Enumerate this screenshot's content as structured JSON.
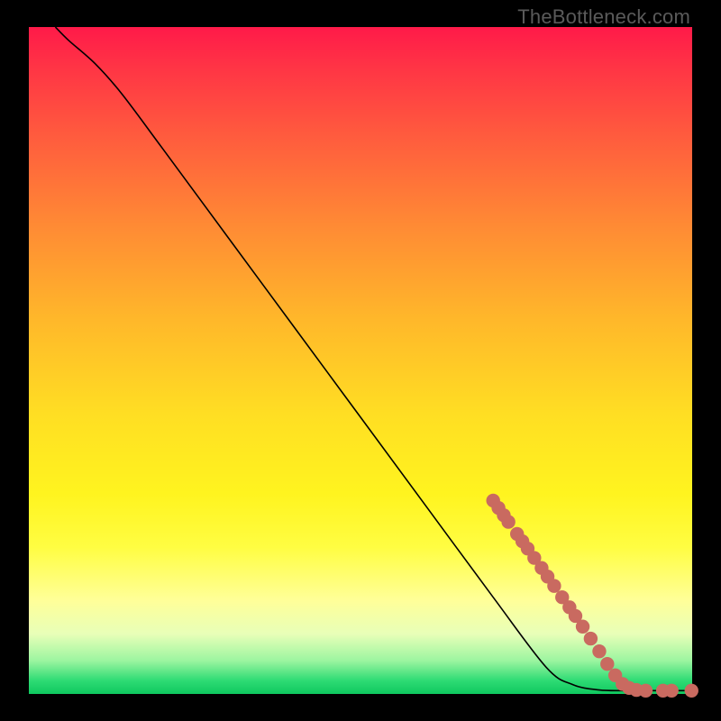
{
  "attribution": "TheBottleneck.com",
  "colors": {
    "dot": "#c96a60",
    "line": "#000000"
  },
  "chart_data": {
    "type": "line",
    "title": "",
    "xlabel": "",
    "ylabel": "",
    "xlim": [
      0,
      100
    ],
    "ylim": [
      0,
      100
    ],
    "curve": [
      {
        "x": 4,
        "y": 100
      },
      {
        "x": 6,
        "y": 98
      },
      {
        "x": 10,
        "y": 94.5
      },
      {
        "x": 14,
        "y": 90
      },
      {
        "x": 20,
        "y": 82
      },
      {
        "x": 30,
        "y": 68.5
      },
      {
        "x": 40,
        "y": 55
      },
      {
        "x": 50,
        "y": 41.5
      },
      {
        "x": 60,
        "y": 28
      },
      {
        "x": 70,
        "y": 14.5
      },
      {
        "x": 78,
        "y": 4
      },
      {
        "x": 82,
        "y": 1.4
      },
      {
        "x": 86,
        "y": 0.6
      },
      {
        "x": 90,
        "y": 0.5
      },
      {
        "x": 95,
        "y": 0.5
      },
      {
        "x": 100,
        "y": 0.5
      }
    ],
    "series": [
      {
        "name": "markers",
        "points": [
          {
            "x": 70.0,
            "y": 29.0
          },
          {
            "x": 70.8,
            "y": 27.9
          },
          {
            "x": 71.6,
            "y": 26.8
          },
          {
            "x": 72.3,
            "y": 25.8
          },
          {
            "x": 73.6,
            "y": 24.0
          },
          {
            "x": 74.4,
            "y": 22.9
          },
          {
            "x": 75.2,
            "y": 21.8
          },
          {
            "x": 76.2,
            "y": 20.4
          },
          {
            "x": 77.3,
            "y": 18.9
          },
          {
            "x": 78.2,
            "y": 17.6
          },
          {
            "x": 79.2,
            "y": 16.2
          },
          {
            "x": 80.4,
            "y": 14.5
          },
          {
            "x": 81.5,
            "y": 13.0
          },
          {
            "x": 82.4,
            "y": 11.7
          },
          {
            "x": 83.5,
            "y": 10.1
          },
          {
            "x": 84.7,
            "y": 8.3
          },
          {
            "x": 86.0,
            "y": 6.4
          },
          {
            "x": 87.2,
            "y": 4.5
          },
          {
            "x": 88.4,
            "y": 2.8
          },
          {
            "x": 89.5,
            "y": 1.5
          },
          {
            "x": 90.5,
            "y": 0.9
          },
          {
            "x": 91.6,
            "y": 0.6
          },
          {
            "x": 93.0,
            "y": 0.5
          },
          {
            "x": 95.6,
            "y": 0.5
          },
          {
            "x": 96.9,
            "y": 0.5
          },
          {
            "x": 99.9,
            "y": 0.5
          }
        ]
      }
    ]
  }
}
